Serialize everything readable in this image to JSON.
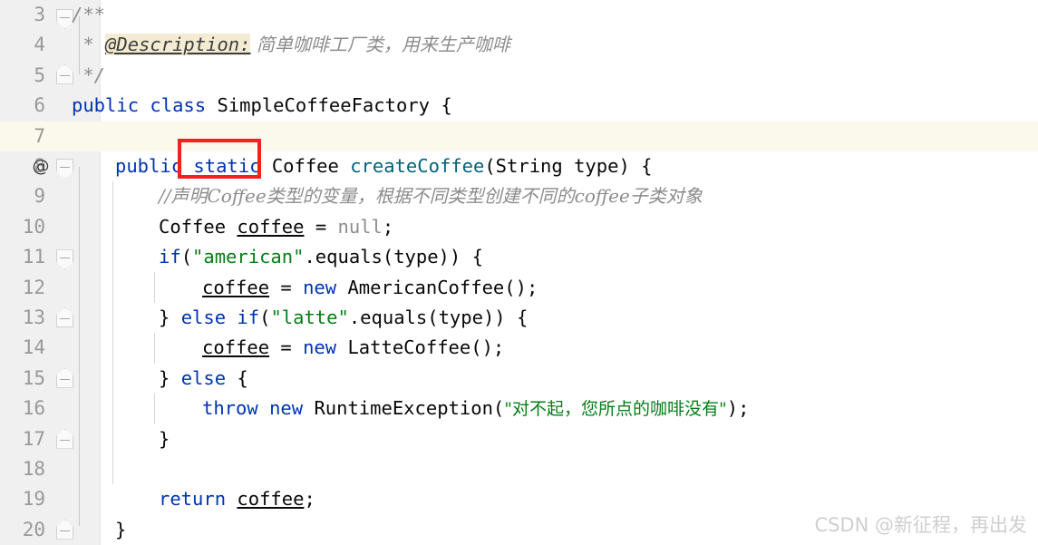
{
  "editor": {
    "first_line_number": 3,
    "current_line_number": 7,
    "annotation_marker": "@",
    "colors": {
      "keyword": "#0033b3",
      "string": "#067d17",
      "method": "#00627a",
      "comment": "#8c8c8c",
      "doc_tag_highlight": "#f3ecd2",
      "current_line_bg": "#fbf8ec",
      "annotation_box": "#f41f1f",
      "gutter_bg": "#f0f0f0"
    }
  },
  "line_numbers": [
    "3",
    "4",
    "5",
    "6",
    "7",
    "8",
    "9",
    "10",
    "11",
    "12",
    "13",
    "14",
    "15",
    "16",
    "17",
    "18",
    "19",
    "20"
  ],
  "code_lines": [
    {
      "number": "3",
      "text": "/**"
    },
    {
      "number": "4",
      "text": " * @Description: 简单咖啡工厂类，用来生产咖啡"
    },
    {
      "number": "5",
      "text": " */"
    },
    {
      "number": "6",
      "text": "public class SimpleCoffeeFactory {"
    },
    {
      "number": "7",
      "text": ""
    },
    {
      "number": "8",
      "text": "    public static Coffee createCoffee(String type) {"
    },
    {
      "number": "9",
      "text": "        //声明Coffee类型的变量，根据不同类型创建不同的coffee子类对象"
    },
    {
      "number": "10",
      "text": "        Coffee coffee = null;"
    },
    {
      "number": "11",
      "text": "        if(\"american\".equals(type)) {"
    },
    {
      "number": "12",
      "text": "            coffee = new AmericanCoffee();"
    },
    {
      "number": "13",
      "text": "        } else if(\"latte\".equals(type)) {"
    },
    {
      "number": "14",
      "text": "            coffee = new LatteCoffee();"
    },
    {
      "number": "15",
      "text": "        } else {"
    },
    {
      "number": "16",
      "text": "            throw new RuntimeException(\"对不起，您所点的咖啡没有\");"
    },
    {
      "number": "17",
      "text": "        }"
    },
    {
      "number": "18",
      "text": ""
    },
    {
      "number": "19",
      "text": "        return coffee;"
    },
    {
      "number": "20",
      "text": "    }"
    }
  ],
  "tokens": {
    "doc_open": "/**",
    "doc_star": " * ",
    "doc_tag": "@Description:",
    "doc_desc": " 简单咖啡工厂类，用来生产咖啡",
    "doc_close": " */",
    "kw_public": "public",
    "kw_class": "class",
    "class_name": "SimpleCoffeeFactory",
    "brace_open": "{",
    "kw_static": "static",
    "type_coffee": "Coffee",
    "method_name": "createCoffee",
    "paren_open": "(",
    "type_string": "String",
    "param_type": "type",
    "paren_close": ")",
    "line_comment": "//声明Coffee类型的变量，根据不同类型创建不同的coffee子类对象",
    "var_coffee": "coffee",
    "eq": "=",
    "kw_null": "null",
    "semi": ";",
    "kw_if": "if",
    "str_american": "\"american\"",
    "dot_equals": ".equals(type)) {",
    "kw_new": "new",
    "cls_american_coffee": "AmericanCoffee();",
    "brace_close_else_if": "} else if",
    "str_latte": "\"latte\"",
    "cls_latte_coffee": "LatteCoffee();",
    "brace_close_else": "} else {",
    "kw_throw": "throw",
    "cls_runtime_exception": "RuntimeException",
    "str_cn_message": "\"对不起，您所点的咖啡没有\"",
    "close_paren_semi": ");",
    "brace_close": "}",
    "kw_return": "return"
  },
  "fold_markers": [
    {
      "line": "3",
      "direction": "down"
    },
    {
      "line": "5",
      "direction": "up"
    },
    {
      "line": "8",
      "direction": "down"
    },
    {
      "line": "11",
      "direction": "down"
    },
    {
      "line": "13",
      "direction": "up"
    },
    {
      "line": "15",
      "direction": "up"
    },
    {
      "line": "17",
      "direction": "up"
    },
    {
      "line": "20",
      "direction": "up"
    }
  ],
  "annotation": {
    "target_token": "static",
    "shape": "rectangle",
    "color": "#f41f1f"
  },
  "watermark": {
    "text": "CSDN @新征程，再出发"
  }
}
